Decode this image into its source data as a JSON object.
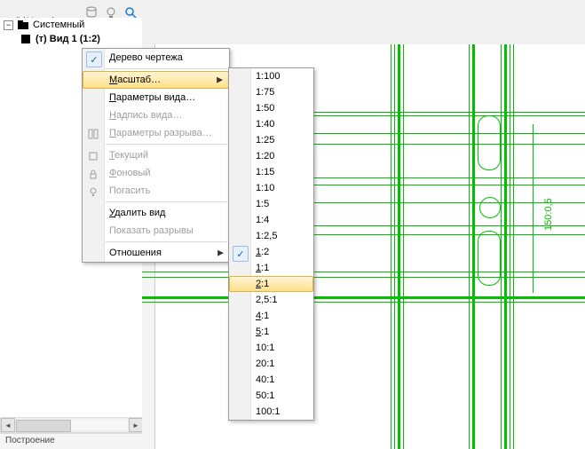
{
  "path": "C:\\Users\\",
  "tree": {
    "root": "Системный",
    "view": "(т) Вид 1 (1:2)"
  },
  "status": "Построение",
  "dimension": "150:0,5",
  "menu": {
    "drawing_tree": "Дерево чертежа",
    "scale": "Масштаб…",
    "view_params": "Параметры вида…",
    "view_caption": "Надпись вида…",
    "break_params": "Параметры разрыва…",
    "current": "Текущий",
    "background": "Фоновый",
    "hide": "Погасить",
    "delete_view": "Удалить вид",
    "show_breaks": "Показать разрывы",
    "relations": "Отношения",
    "scale_u": "М",
    "scale_rest": "асштаб…",
    "vp_u": "П",
    "vp_rest": "араметры вида…",
    "vc_u": "Н",
    "vc_rest": "адпись вида…",
    "bp_u": "П",
    "bp_rest": "араметры разрыва…",
    "cur_u": "Т",
    "cur_rest": "екущий",
    "bg_u": "Ф",
    "bg_rest": "оновый",
    "hide_rest": "огасить",
    "del_u": "У",
    "del_rest": "далить вид",
    "sb_rest": "оказать разрывы"
  },
  "scales": [
    {
      "label": "1:100",
      "u": ""
    },
    {
      "label": "1:75",
      "u": ""
    },
    {
      "label": "1:50",
      "u": ""
    },
    {
      "label": "1:40",
      "u": ""
    },
    {
      "label": "1:25",
      "u": ""
    },
    {
      "label": "1:20",
      "u": ""
    },
    {
      "label": "1:15",
      "u": ""
    },
    {
      "label": "1:10",
      "u": ""
    },
    {
      "label": "1:5",
      "u": ""
    },
    {
      "label": "1:4",
      "u": ""
    },
    {
      "label": "1:2,5",
      "u": ""
    },
    {
      "label": "1:2",
      "u": "1",
      "rest": ":2",
      "checked": true
    },
    {
      "label": "1:1",
      "u": "1",
      "rest": ":1"
    },
    {
      "label": "2:1",
      "u": "2",
      "rest": ":1",
      "hl": true
    },
    {
      "label": "2,5:1",
      "u": ""
    },
    {
      "label": "4:1",
      "u": "4",
      "rest": ":1"
    },
    {
      "label": "5:1",
      "u": "5",
      "rest": ":1"
    },
    {
      "label": "10:1",
      "u": ""
    },
    {
      "label": "20:1",
      "u": ""
    },
    {
      "label": "40:1",
      "u": ""
    },
    {
      "label": "50:1",
      "u": ""
    },
    {
      "label": "100:1",
      "u": ""
    }
  ]
}
